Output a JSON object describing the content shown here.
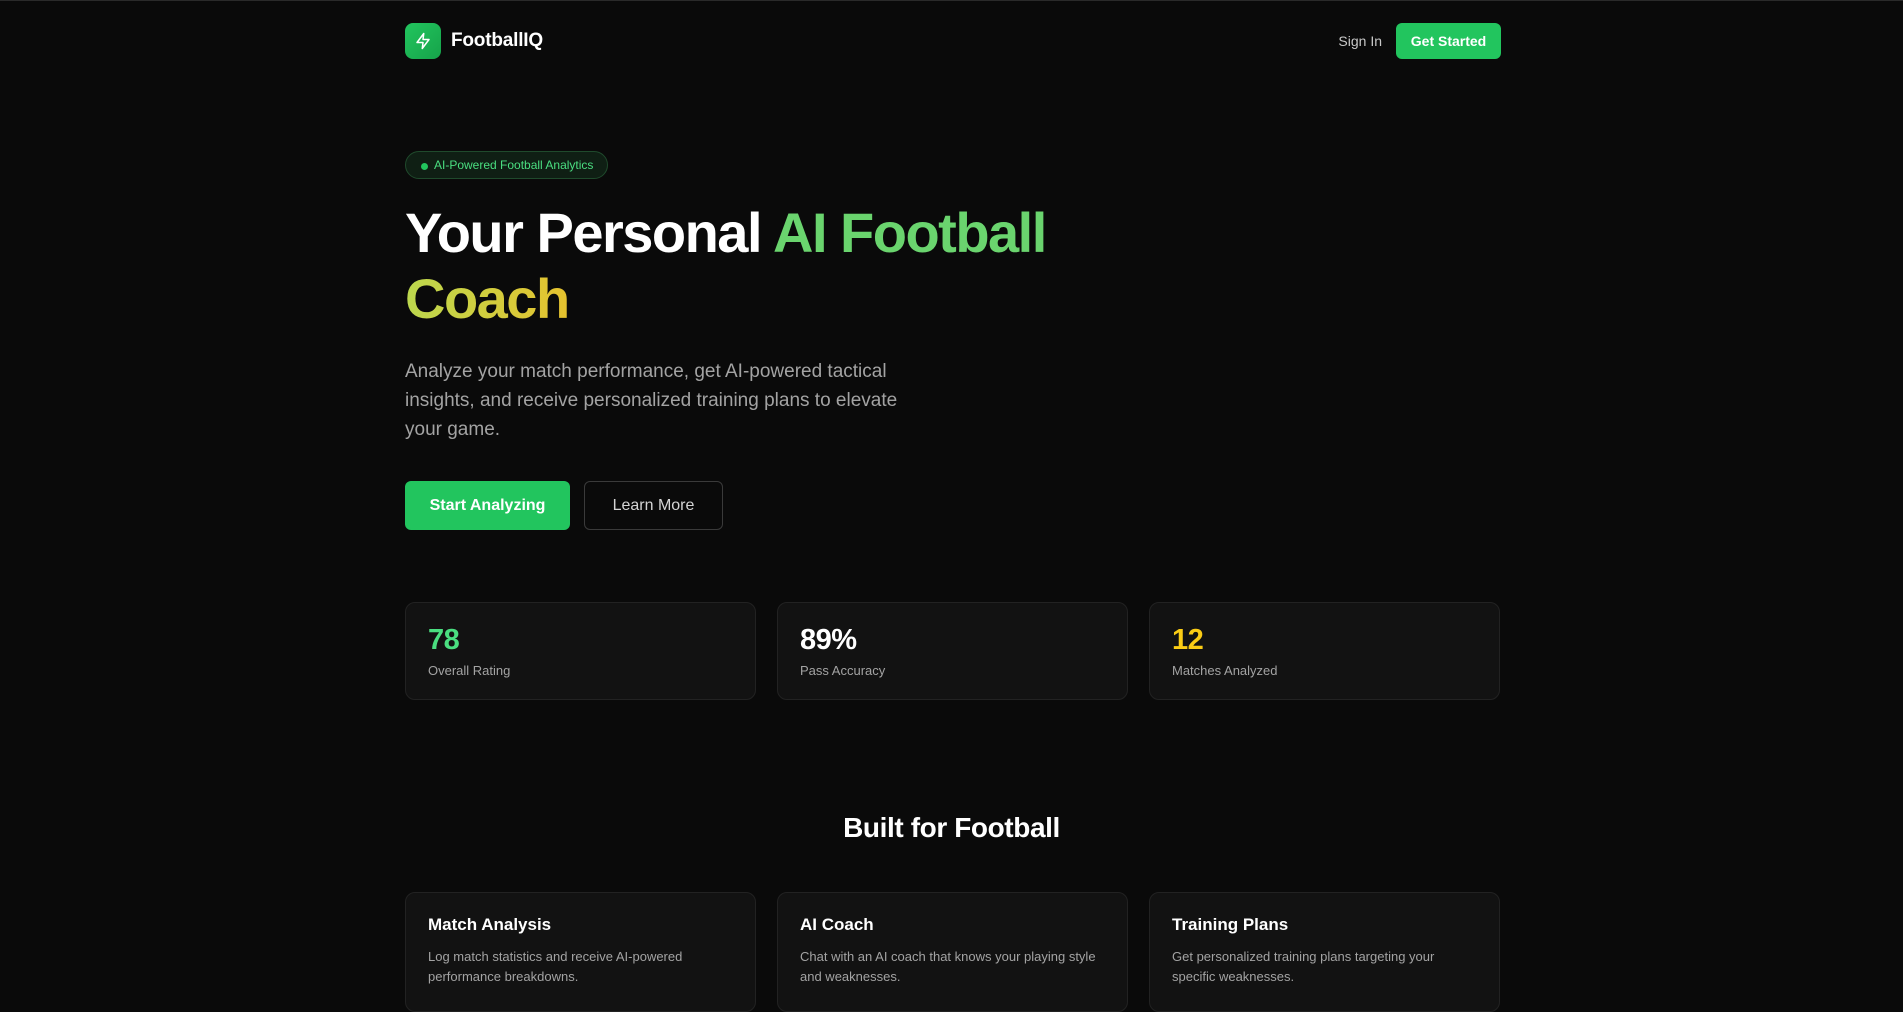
{
  "header": {
    "brand": "FootballIQ",
    "signin_label": "Sign In",
    "cta_label": "Get Started"
  },
  "hero": {
    "badge": "AI-Powered Football Analytics",
    "title_part1": "Your Personal ",
    "title_part2": "AI Football",
    "title_part3": "Coach",
    "subtitle": "Analyze your match performance, get AI-powered tactical insights, and receive personalized training plans to elevate your game.",
    "primary_button": "Start Analyzing",
    "secondary_button": "Learn More"
  },
  "stats": [
    {
      "value": "78",
      "label": "Overall Rating",
      "color": "#4ade80"
    },
    {
      "value": "89%",
      "label": "Pass Accuracy",
      "color": "#ffffff"
    },
    {
      "value": "12",
      "label": "Matches Analyzed",
      "color": "#facc15"
    }
  ],
  "features": {
    "title": "Built for Football",
    "items": [
      {
        "title": "Match Analysis",
        "desc": "Log match statistics and receive AI-powered performance breakdowns."
      },
      {
        "title": "AI Coach",
        "desc": "Chat with an AI coach that knows your playing style and weaknesses."
      },
      {
        "title": "Training Plans",
        "desc": "Get personalized training plans targeting your specific weaknesses."
      }
    ]
  },
  "colors": {
    "accent": "#22c55e",
    "background": "#0a0a0a",
    "card": "#121212"
  },
  "icons": {
    "logo": "lightning-bolt-icon"
  }
}
